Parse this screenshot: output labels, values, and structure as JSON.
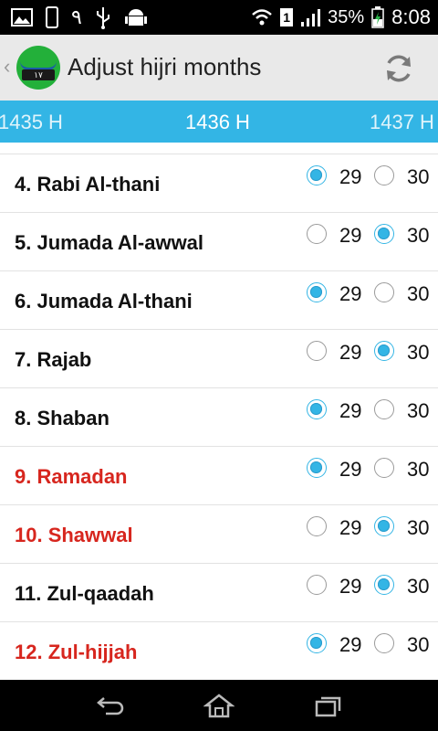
{
  "status_bar": {
    "battery_percent": "35%",
    "time": "8:08",
    "sim_label": "1",
    "icons": [
      "image-icon",
      "phone-icon",
      "arabic-numeral-icon",
      "usb-icon",
      "android-icon",
      "wifi-icon",
      "sim-icon",
      "signal-icon",
      "battery-charging-icon"
    ],
    "notification_digit": "٩"
  },
  "action_bar": {
    "title": "Adjust hijri months",
    "logo_text": "١٧",
    "up_caret": "‹",
    "refresh_icon": "refresh-icon"
  },
  "year_tabs": {
    "prev": "1435 H",
    "current": "1436 H",
    "next": "1437 H"
  },
  "colors": {
    "accent": "#33b5e5",
    "holy_month": "#d7261e",
    "action_bar_bg": "#e9e9e9"
  },
  "months": [
    {
      "label": "4. Rabi Al-thani",
      "highlight": false,
      "selected": "29",
      "opt1": "29",
      "opt2": "30"
    },
    {
      "label": "5. Jumada Al-awwal",
      "highlight": false,
      "selected": "30",
      "opt1": "29",
      "opt2": "30"
    },
    {
      "label": "6. Jumada Al-thani",
      "highlight": false,
      "selected": "29",
      "opt1": "29",
      "opt2": "30"
    },
    {
      "label": "7. Rajab",
      "highlight": false,
      "selected": "30",
      "opt1": "29",
      "opt2": "30"
    },
    {
      "label": "8. Shaban",
      "highlight": false,
      "selected": "29",
      "opt1": "29",
      "opt2": "30"
    },
    {
      "label": "9. Ramadan",
      "highlight": true,
      "selected": "29",
      "opt1": "29",
      "opt2": "30"
    },
    {
      "label": "10. Shawwal",
      "highlight": true,
      "selected": "30",
      "opt1": "29",
      "opt2": "30"
    },
    {
      "label": "11. Zul-qaadah",
      "highlight": false,
      "selected": "30",
      "opt1": "29",
      "opt2": "30"
    },
    {
      "label": "12. Zul-hijjah",
      "highlight": true,
      "selected": "29",
      "opt1": "29",
      "opt2": "30"
    }
  ],
  "nav_bar": {
    "icons": [
      "back-icon",
      "home-icon",
      "recent-apps-icon"
    ]
  }
}
